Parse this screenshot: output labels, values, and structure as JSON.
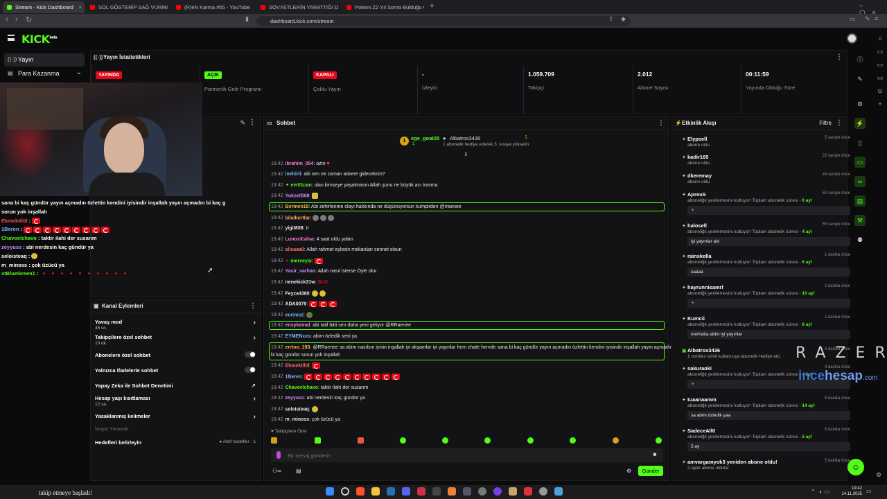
{
  "browser": {
    "tabs": [
      {
        "title": "Stream - Kick Dashboard",
        "active": true
      },
      {
        "title": "SOL GÖSTERİP SAĞ VURMAK | Sönd"
      },
      {
        "title": "(R)eN Karma #65 - YouTube"
      },
      {
        "title": "SOVYETLERİN YARATTIĞI DÜNYANIN"
      },
      {
        "title": "Poleon Z2 Yıl Sonra Bulduğu Gerçek !"
      }
    ],
    "url": "dashboard.kick.com/stream"
  },
  "kick": {
    "logo": "KICK",
    "logo_sup": "beta"
  },
  "nav": {
    "stream": "Yayın",
    "monetize": "Para Kazanma"
  },
  "stats": {
    "title": "Yayın İstatistikleri",
    "items": [
      {
        "badge": "YAYINDA",
        "value": "",
        "label": ""
      },
      {
        "badge": "AÇIK",
        "value": "",
        "label": "Partnerlik Gelir Programı"
      },
      {
        "badge": "KAPALI",
        "value": "",
        "label": "Çoklu Yayın"
      },
      {
        "badge": "",
        "value": "-",
        "label": "İzleyici"
      },
      {
        "badge": "",
        "value": "1.059.709",
        "label": "Takipçi"
      },
      {
        "badge": "",
        "value": "2.012",
        "label": "Abone Sayısı"
      },
      {
        "badge": "",
        "value": "00:11:59",
        "label": "Yayında Olduğu Süre"
      }
    ]
  },
  "overlay_chat": [
    {
      "user": "",
      "text": "sana bi kaç gündür yayın açmadın özlettin kendini iyisindir inşallah yayın açmadın bi kaç g"
    },
    {
      "user": "",
      "text": "sorun yok inşallah"
    },
    {
      "user": "Ekmektilöl",
      "text": "",
      "flags": 1
    },
    {
      "user": "1Beren",
      "text": "",
      "flags": 9
    },
    {
      "user": "Chavoelchavo",
      "text": "taktir ilahi der susarım"
    },
    {
      "user": "zeyyuss",
      "text": "abi nerdesin kaç gündür ya"
    },
    {
      "user": "seloisteaq",
      "text": ""
    },
    {
      "user": "m_minoss",
      "text": "çok üzücü ya"
    },
    {
      "user": "xtBlueGreen1",
      "text": "",
      "dots": 10
    }
  ],
  "channel_actions": {
    "title": "Kanal Eylemleri",
    "rows": [
      {
        "label": "Yavaş mod",
        "sub": "45 sn.",
        "control": "chevron"
      },
      {
        "label": "Takipçilere özel sohbet",
        "sub": "10 dk.",
        "control": "chevron"
      },
      {
        "label": "Abonelere özel sohbet",
        "sub": "",
        "control": "toggle"
      },
      {
        "label": "Yalnızca ifadelerle sohbet",
        "sub": "",
        "control": "toggle"
      },
      {
        "label": "Yapay Zeka ile Sohbet Denetimi",
        "sub": "",
        "control": "external"
      },
      {
        "label": "Hesap yaşı kısıtlaması",
        "sub": "12 sa.",
        "control": "chevron"
      },
      {
        "label": "Yasaklanmış kelimeler",
        "sub": "",
        "control": "chevron"
      }
    ],
    "section": "İzleyici Yönlendir",
    "goals": "Hedefleri belirleyin",
    "goals_status": "Aktif hedefler · 1"
  },
  "chat": {
    "title": "Sohbet",
    "pinned": {
      "user1": "ege_goat35",
      "count1": "1",
      "user2": "Albatros3436",
      "count2": "1",
      "note": "1 abonelik hediye ederek 3. sıraya yükselin"
    },
    "messages": [
      {
        "t": "19:42",
        "u": "ibrahim_054",
        "c": "#ff7ad9",
        "m": "aztn"
      },
      {
        "t": "19:42",
        "u": "inehirli",
        "c": "#7ab8ff",
        "m": "abi sen ne zaman askere gideceksin?"
      },
      {
        "t": "19:42",
        "u": "evr01can",
        "c": "#53fc18",
        "m": "ulan kimseye yaşatmasın Allah şunu ne büyük acı travma"
      },
      {
        "t": "19:42",
        "u": "YukselB68",
        "c": "#c98bff",
        "m": ""
      },
      {
        "t": "19:42",
        "u": "Bermen18",
        "c": "#ffb347",
        "m": "Abi zehirlenme olayı hakkında ne düşünüyorsun kumpirden @rraenee",
        "hl": true
      },
      {
        "t": "19:42",
        "u": "bilalkurtlar",
        "c": "#ff9f6b",
        "m": ""
      },
      {
        "t": "19:42",
        "u": "yigit808",
        "c": "#eeeeee",
        "m": "tr"
      },
      {
        "t": "19:42",
        "u": "LunosXsilva",
        "c": "#ff7ad9",
        "m": "4 saat oldu yalan"
      },
      {
        "t": "19:42",
        "u": "alisaaa0",
        "c": "#ff6b6b",
        "m": "Allah rahmet eylesin mekanları cennet olsun"
      },
      {
        "t": "19:42",
        "u": "merveysi",
        "c": "#53fc18",
        "m": ""
      },
      {
        "t": "19:42",
        "u": "Yasir_varhan",
        "c": "#c98bff",
        "m": "Allah nasıl isterse Öyle olur"
      },
      {
        "t": "19:42",
        "u": "nenekick31w",
        "c": "#eeeeee",
        "m": "SUX"
      },
      {
        "t": "19:42",
        "u": "Feyza4380",
        "c": "#eeeeee",
        "m": ""
      },
      {
        "t": "19:42",
        "u": "ADA0079",
        "c": "#eeeeee",
        "m": ""
      },
      {
        "t": "19:42",
        "u": "ecrinnzi",
        "c": "#7ab8ff",
        "m": ""
      },
      {
        "t": "19:42",
        "u": "ensykemal",
        "c": "#ff7ad9",
        "m": "abi tatil bitti sen daha yeni geliyor @RRaenee",
        "hl": true
      },
      {
        "t": "19:42",
        "u": "EYMENxxs",
        "c": "#7ab8ff",
        "m": "abim özledik seni ya"
      },
      {
        "t": "19:42",
        "u": "errtoo_193",
        "c": "#ffb347",
        "m": "@RRaenee sa abim nasılsın iyisin inşallah iyi akşamlar iyi yayınlar hem chate hemde sana bi kaç gündür yayın açmadın özlettin kendini iyisindir inşallah yayın açmadın",
        "m2": "bi kaç gündür sorun yok inşallah",
        "hl": true
      },
      {
        "t": "19:42",
        "u": "Ekmektilöl",
        "c": "#ff6b6b",
        "m": ""
      },
      {
        "t": "19:42",
        "u": "1Beren",
        "c": "#7ab8ff",
        "m": ""
      },
      {
        "t": "19:42",
        "u": "Chavoelchavo",
        "c": "#53fc18",
        "m": "taktir ilahi der susarım"
      },
      {
        "t": "19:42",
        "u": "zeyyuss",
        "c": "#c98bff",
        "m": "abi nerdesin kaç gündür ya"
      },
      {
        "t": "19:42",
        "u": "seloisteaq",
        "c": "#eeeeee",
        "m": ""
      },
      {
        "t": "19:42",
        "u": "m_minoss",
        "c": "#eeeeee",
        "m": "çok üzücü ya"
      }
    ],
    "followers_only": "Takipçilere Özel",
    "input_placeholder": "Bir mesaj gönderin",
    "send": "Gönder"
  },
  "activity": {
    "title": "Etkinlik Akışı",
    "filter": "Filtre",
    "items": [
      {
        "name": "Elypsell",
        "sub": "abone oldu",
        "time": "5 saniye önce"
      },
      {
        "name": "kadir165",
        "sub": "abone oldu",
        "time": "22 saniye önce"
      },
      {
        "name": "dkeremay",
        "sub": "abone oldu",
        "time": "49 saniye önce"
      },
      {
        "name": "ApreuS",
        "sub": "aboneliğk yenilemesini kutluyor! Toplam abonelik süresi - ",
        "months": "6 ay!",
        "box": "",
        "time": "50 saniye önce"
      },
      {
        "name": "halosell",
        "sub": "aboneliğk yenilemesini kutluyor! Toplam abonelik süresi - ",
        "months": "4 ay!",
        "box": "iyi yayınlar abi",
        "time": "55 saniye önce"
      },
      {
        "name": "rainskella",
        "sub": "aboneliğk yenilemesini kutluyor! Toplam abonelik süresi - ",
        "months": "6 ay!",
        "box": "saaaa",
        "time": "1 dakika önce"
      },
      {
        "name": "hayrunnisamrl",
        "sub": "aboneliğk yenilemesini kutluyor! Toplam abonelik süresi - ",
        "months": "10 ay!",
        "box": "",
        "time": "2 dakika önce"
      },
      {
        "name": "Kumcii",
        "sub": "aboneliğk yenilemesini kutluyor! Toplam abonelik süresi - ",
        "months": "8 ay!",
        "box": "merhaba abim iyi yayınlar",
        "time": "2 dakika önce"
      },
      {
        "name": "Albatros3436",
        "sub": "1 norblex isimli kullanıcıya abonelik hediye etti.",
        "time": "3 dakika önce"
      },
      {
        "name": "sakuraoki",
        "sub": "aboneliğk yenilemesini kutluyor! Toplam abonelik süresi - ",
        "months": "4 ay!",
        "box": "",
        "time": "4 dakika önce"
      },
      {
        "name": "tuaanaamm",
        "sub": "aboneliğk yenilemesini kutluyor! Toplam abonelik süresi - ",
        "months": "14 ay!",
        "box": "sa abim özledik yaa",
        "time": "5 dakika önce"
      },
      {
        "name": "SadeceAll0",
        "sub": "aboneliğk yenilemesini kutluyor! Toplam abonelik süresi - ",
        "months": "5 ay!",
        "box": "5 ay",
        "time": "5 dakika önce"
      },
      {
        "name": "amvargamyok3 yeniden abone oldu!",
        "sub": "2 aylık abone oldular",
        "time": "5 dakika önce"
      }
    ]
  },
  "watermark": {
    "brand": "RAZER",
    "site1": "ince",
    "site2": "hesap",
    "site3": ".com"
  },
  "taskbar": {
    "notice": "takip etmeye başladı!",
    "time": "19:42",
    "date": "14.11.2025"
  },
  "colors": {
    "accent": "#53fc18",
    "live": "#e30a17"
  }
}
